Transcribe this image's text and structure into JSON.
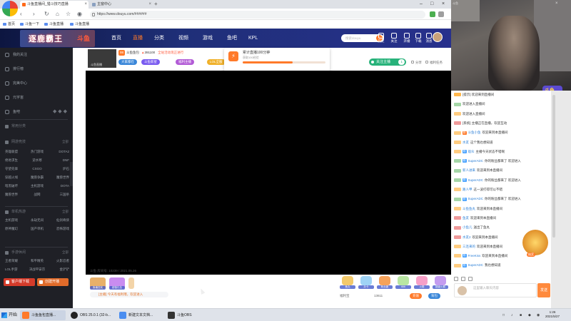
{
  "browser": {
    "tabs": [
      {
        "label": "斗鱼直播间_猎斗技巧直播",
        "active": true
      },
      {
        "label": "主窗中心",
        "active": false
      }
    ],
    "url": "https://www.douyu.com/######",
    "bookmarks": [
      "首页",
      "斗鱼一下",
      "斗鱼直播",
      "斗鱼直播"
    ]
  },
  "site": {
    "banner_text": "逐鹿霸王",
    "banner_logo": "斗鱼",
    "nav": [
      "首页",
      "直播",
      "分类",
      "视频",
      "游戏",
      "鱼吧",
      "KPL"
    ],
    "active_nav": "直播",
    "search_placeholder": "搜索douyu",
    "header_icons": [
      "历史",
      "关注",
      "开播",
      "下载",
      "消息"
    ],
    "accent_color": "#ff7a2a"
  },
  "sidebar": {
    "top_items": [
      "我的关注",
      "排行榜",
      "完美中心",
      "元宇宙",
      "鱼吧"
    ],
    "common_section": "常用分类",
    "sections": [
      {
        "title": "网游竞技",
        "more": "全部",
        "items": [
          "英雄联盟",
          "热门游戏",
          "DOTA2",
          "绝地求生",
          "逆水寒",
          "DNF",
          "守望先锋",
          "CSGO",
          "炉石",
          "穿越火线",
          "魔兽争霸",
          "魔兽世界",
          "暗黑破坏",
          "主机游戏",
          "DOTA",
          "魔兽世界",
          "战网",
          "三国杀"
        ]
      },
      {
        "title": "单机热游",
        "more": "全部",
        "items": [
          "主机游戏",
          "永劫无间",
          "仙剑奇侠",
          "原神魔幻",
          "国产单机",
          "恐怖游戏"
        ]
      },
      {
        "title": "手游休闲",
        "more": "全部",
        "items": [
          "王者荣耀",
          "和平精英",
          "火影忍者",
          "LOL手游",
          "决战平安京",
          "金铲铲"
        ]
      }
    ],
    "bottom_buttons": [
      "客户端下载",
      "创建开播"
    ]
  },
  "room": {
    "thumb_label": "斗鱼直播",
    "level": "98",
    "name": "斗鱼鱼包",
    "hot": "391100",
    "activity": "全站活动现正进行",
    "tags": [
      {
        "label": "大家都在",
        "color": "#3a87d9"
      },
      {
        "label": "斗鱼新星",
        "color": "#7a5cf0"
      },
      {
        "label": "福利主播",
        "color": "#b25bd6"
      },
      {
        "label": "LOL全服",
        "color": "#f0b12a"
      }
    ],
    "card_title": "累计直播100分钟",
    "card_sub": "获取100经验",
    "card_progress": 0.6,
    "follow_label": "关注主播",
    "follow_count": "1",
    "links": [
      "分享",
      "福利任务"
    ],
    "player_info": "斗鱼 房间号: 10239 / 2021.05.26",
    "activities": [
      "鱼塘狂欢",
      "超值礼包"
    ],
    "announce": "[主播] 今天有福利哦，欢迎进入",
    "gifts": [
      "鱼丸",
      "办卡",
      "粉丝团",
      "666",
      "火箭",
      "超级火箭"
    ],
    "bottom_left": "福利宝",
    "bottom_value": "13611",
    "bottom_buttons": [
      "充值",
      "背包"
    ]
  },
  "cam": {
    "overlay_title": "斗鱼",
    "badge_text": "斗鱼"
  },
  "chat": {
    "messages": [
      {
        "level": "#ffb74d",
        "fan": "",
        "user": "",
        "text": "[提示] 欢迎来到直播间",
        "fan_color": ""
      },
      {
        "level": "#a5d6a7",
        "fan": "",
        "user": "",
        "text": "欢迎进入直播间",
        "fan_color": ""
      },
      {
        "level": "#ffcc80",
        "fan": "",
        "user": "",
        "text": "欢迎进入直播间",
        "fan_color": ""
      },
      {
        "level": "#ef9a9a",
        "fan": "",
        "user": "",
        "text": "[系统] 主播正在直播，欢迎互动",
        "fan_color": ""
      },
      {
        "level": "#ffcc80",
        "fan": "粉",
        "user": "斗鱼小鱼",
        "text": "欢迎来到本直播间",
        "fan_color": "#ff7a2a"
      },
      {
        "level": "#ffcc80",
        "fan": "",
        "user": "水友",
        "text": "这个我也想知道",
        "fan_color": ""
      },
      {
        "level": "#ffcc80",
        "fan": "粉",
        "user": "观众",
        "text": "主播今天状态不错啊",
        "fan_color": "#4aa3ff"
      },
      {
        "level": "#a5d6a7",
        "fan": "粉",
        "user": "SuperADC",
        "text": "你的粉丝都来了 欢迎进入",
        "fan_color": "#4aa3ff"
      },
      {
        "level": "#a5d6a7",
        "fan": "",
        "user": "新人进来",
        "text": "欢迎来到本直播间",
        "fan_color": ""
      },
      {
        "level": "#a5d6a7",
        "fan": "粉",
        "user": "SuperADC",
        "text": "你的粉丝都来了 欢迎进入",
        "fan_color": "#4aa3ff"
      },
      {
        "level": "#ffcc80",
        "fan": "",
        "user": "路人甲",
        "text": "这一波打得可以不错",
        "fan_color": ""
      },
      {
        "level": "#a5d6a7",
        "fan": "粉",
        "user": "SuperADC",
        "text": "你的粉丝都来了 欢迎进入",
        "fan_color": "#4aa3ff"
      },
      {
        "level": "#ffcc80",
        "fan": "",
        "user": "斗鱼鱼丸",
        "text": "欢迎来到本直播间",
        "fan_color": ""
      },
      {
        "level": "#ef9a9a",
        "fan": "",
        "user": "鱼友",
        "text": "欢迎来到本直播间",
        "fan_color": ""
      },
      {
        "level": "#ef9a9a",
        "fan": "",
        "user": "小鱼儿",
        "text": "送出了鱼丸",
        "fan_color": ""
      },
      {
        "level": "#ef9a9a",
        "fan": "",
        "user": "水友2",
        "text": "欢迎来到本直播间",
        "fan_color": ""
      },
      {
        "level": "#ffcc80",
        "fan": "",
        "user": "三连来的",
        "text": "欢迎来到本直播间",
        "fan_color": ""
      },
      {
        "level": "#ffcc80",
        "fan": "粉",
        "user": "FreeKiss",
        "text": "欢迎来到本直播间",
        "fan_color": "#4aa3ff"
      },
      {
        "level": "#ffcc80",
        "fan": "粉",
        "user": "SuperADC",
        "text": "我也想知道",
        "fan_color": "#4aa3ff"
      }
    ],
    "input_placeholder": "这里输入聊天内容",
    "send_label": "发送",
    "lottery_label": "抽奖"
  },
  "taskbar": {
    "start": "开始",
    "tasks": [
      {
        "label": "斗鱼鱼包直播...",
        "active": true,
        "color": "#ff7a2a"
      },
      {
        "label": "OBS 25.0.1 (32-b...",
        "active": false,
        "color": "#222"
      },
      {
        "label": "新建文本文档...",
        "active": false,
        "color": "#4a8df0"
      },
      {
        "label": "斗鱼OBS",
        "active": false,
        "color": "#333"
      }
    ],
    "time": "1:26",
    "date": "2021/5/27"
  }
}
